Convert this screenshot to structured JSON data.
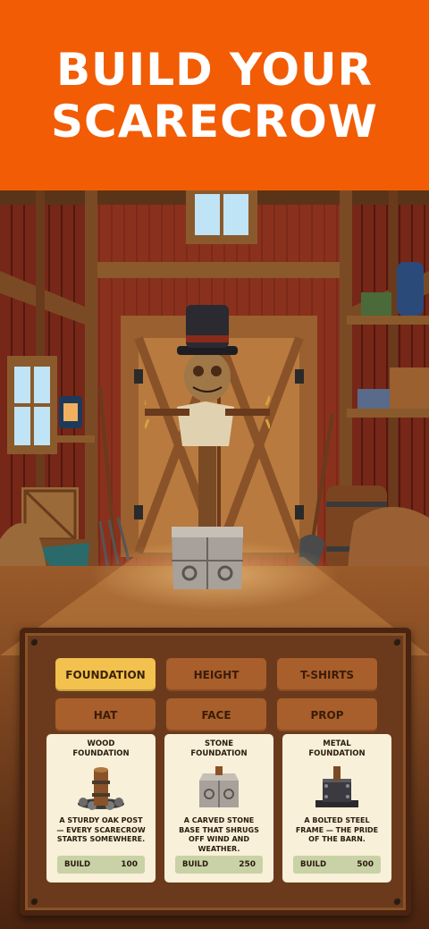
{
  "header": {
    "title_line1": "BUILD YOUR",
    "title_line2": "SCARECROW"
  },
  "colors": {
    "banner": "#f25c05",
    "tab_active": "#f2c14e",
    "tab_inactive": "#a95f2b",
    "card_bg": "#f8f0d8",
    "build_bar": "#c9d2a6"
  },
  "tabs": [
    {
      "label": "Foundation",
      "active": true
    },
    {
      "label": "Height",
      "active": false
    },
    {
      "label": "T-Shirts",
      "active": false
    },
    {
      "label": "Hat",
      "active": false
    },
    {
      "label": "Face",
      "active": false
    },
    {
      "label": "Prop",
      "active": false
    }
  ],
  "cards": [
    {
      "title": "Wood Foundation",
      "icon": "wood-post-icon",
      "description": "A sturdy oak post — every scarecrow starts somewhere.",
      "build_label": "Build",
      "price": "100"
    },
    {
      "title": "Stone Foundation",
      "icon": "stone-block-icon",
      "description": "A carved stone base that shrugs off wind and weather.",
      "build_label": "Build",
      "price": "250"
    },
    {
      "title": "Metal Foundation",
      "icon": "steel-frame-icon",
      "description": "A bolted steel frame — the pride of the barn.",
      "build_label": "Build",
      "price": "500"
    }
  ]
}
